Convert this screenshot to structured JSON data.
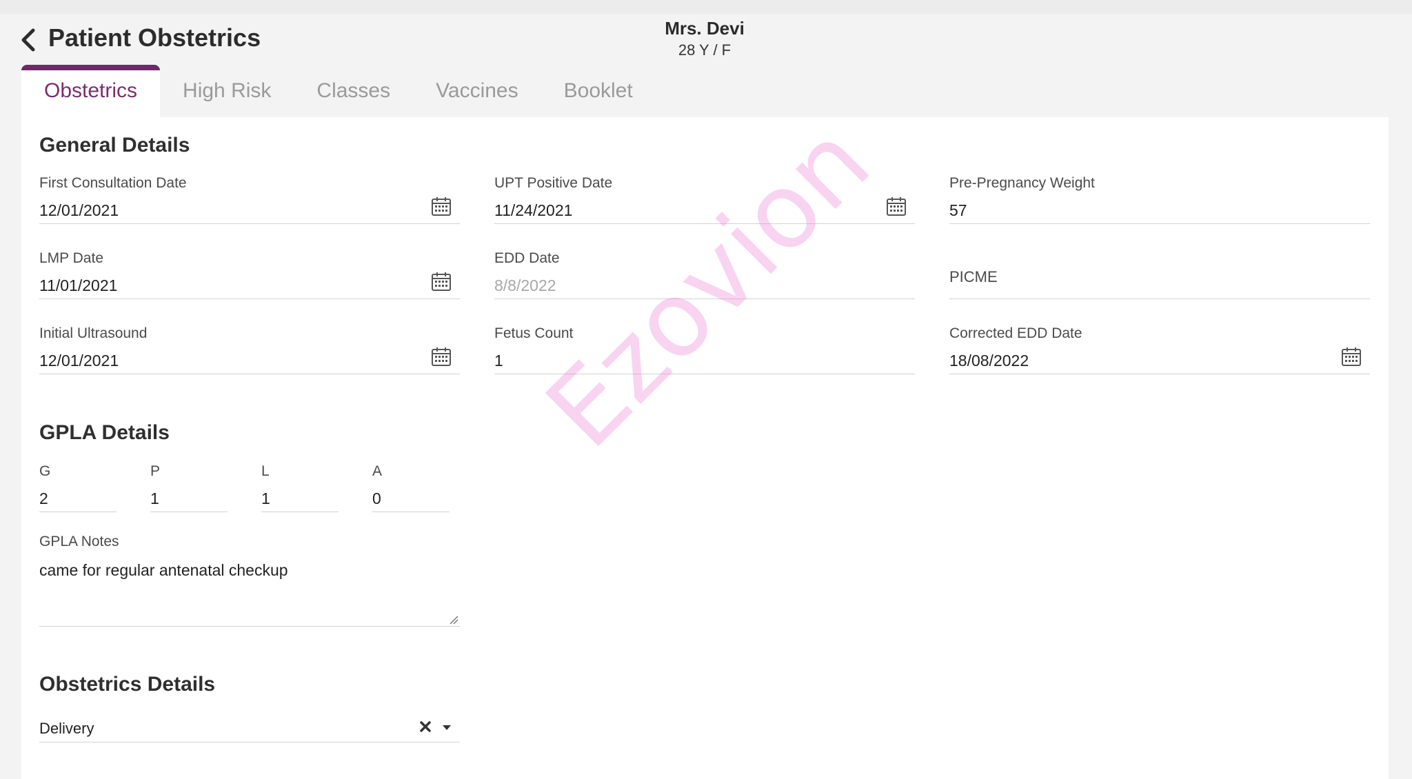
{
  "header": {
    "title": "Patient Obstetrics",
    "back_icon": "chevron-left-icon",
    "patient_name": "Mrs. Devi",
    "patient_info": "28 Y / F"
  },
  "tabs": [
    {
      "label": "Obstetrics",
      "active": true
    },
    {
      "label": "High Risk",
      "active": false
    },
    {
      "label": "Classes",
      "active": false
    },
    {
      "label": "Vaccines",
      "active": false
    },
    {
      "label": "Booklet",
      "active": false
    }
  ],
  "general": {
    "title": "General Details",
    "first_consultation": {
      "label": "First Consultation Date",
      "value": "12/01/2021"
    },
    "upt_positive": {
      "label": "UPT Positive Date",
      "value": "11/24/2021"
    },
    "pre_pregnancy_weight": {
      "label": "Pre-Pregnancy Weight",
      "value": "57"
    },
    "lmp": {
      "label": "LMP Date",
      "value": "11/01/2021"
    },
    "edd": {
      "label": "EDD Date",
      "value": "8/8/2022"
    },
    "picme": {
      "label": "PICME"
    },
    "initial_ultrasound": {
      "label": "Initial Ultrasound",
      "value": "12/01/2021"
    },
    "fetus_count": {
      "label": "Fetus Count",
      "value": "1"
    },
    "corrected_edd": {
      "label": "Corrected EDD Date",
      "value": "18/08/2022"
    }
  },
  "gpla": {
    "title": "GPLA Details",
    "g": {
      "label": "G",
      "value": "2"
    },
    "p": {
      "label": "P",
      "value": "1"
    },
    "l": {
      "label": "L",
      "value": "1"
    },
    "a": {
      "label": "A",
      "value": "0"
    },
    "notes_label": "GPLA Notes",
    "notes_value": "came for regular antenatal checkup"
  },
  "obstetrics": {
    "title": "Obstetrics Details",
    "selected": "Delivery"
  },
  "watermark": "Ezovion",
  "colors": {
    "accent": "#6e2a67",
    "active_tab_text": "#7b2d6e",
    "watermark": "#e878d2"
  }
}
